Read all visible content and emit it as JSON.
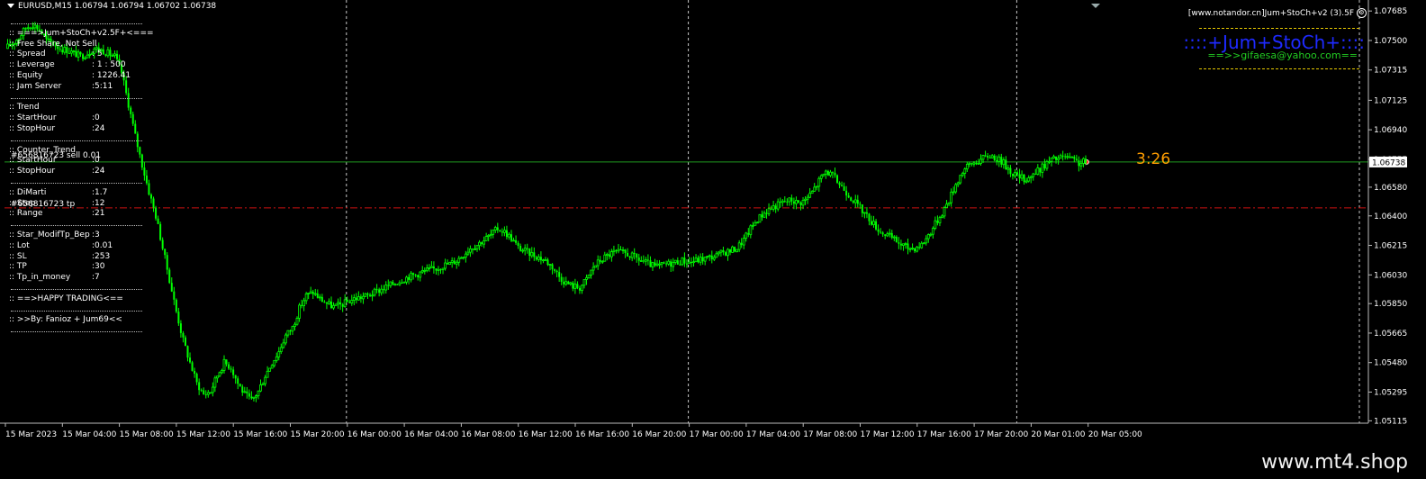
{
  "header": {
    "symbol_info": "EURUSD,M15  1.06794 1.06794 1.06702 1.06738"
  },
  "indicator": {
    "name": "[www.notandor.cn]Jum+StoCh+v2 (3).5F",
    "brand": "::::+Jum+StoCh+::::",
    "email": "==>>gifaesa@yahoo.com=="
  },
  "timer": "3:26",
  "orders": {
    "sell_label": "#656816723 sell 0.01",
    "tp_label": "#656816723 tp"
  },
  "panel": [
    {
      "type": "sep"
    },
    {
      "label": ":: ===>Jum+StoCh+v2.5F+<==="
    },
    {
      "label": ":: Free Share, Not Sell"
    },
    {
      "label": ":: Spread",
      "value": ": 5"
    },
    {
      "label": ":: Leverage",
      "value": ": 1 : 500"
    },
    {
      "label": ":: Equity",
      "value": ": 1226.41"
    },
    {
      "label": ":: Jam Server",
      "value": "  :5:11"
    },
    {
      "type": "sep"
    },
    {
      "label": ":: Trend"
    },
    {
      "label": ":: StartHour",
      "value": ":0"
    },
    {
      "label": ":: StopHour",
      "value": ":24"
    },
    {
      "type": "sep"
    },
    {
      "label": ":: Counter_Trend"
    },
    {
      "label": ":: StartHour",
      "value": ":0"
    },
    {
      "label": ":: StopHour",
      "value": ":24"
    },
    {
      "type": "sep"
    },
    {
      "label": ":: DiMarti",
      "value": ":1.7"
    },
    {
      "label": ":: Step",
      "value": ":12"
    },
    {
      "label": ":: Range",
      "value": ":21"
    },
    {
      "type": "sep"
    },
    {
      "label": ":: Star_ModifTp_Bep",
      "value": ":3"
    },
    {
      "label": ":: Lot",
      "value": ":0.01"
    },
    {
      "label": ":: SL",
      "value": ":253"
    },
    {
      "label": ":: TP",
      "value": ":30"
    },
    {
      "label": ":: Tp_in_money",
      "value": ":7"
    },
    {
      "type": "sep"
    },
    {
      "label": ":: ==>HAPPY TRADING<=="
    },
    {
      "type": "sep"
    },
    {
      "label": ":: >>By: Fanioz + Jum69<<"
    },
    {
      "type": "sep"
    }
  ],
  "footer": {
    "watermark": "www.mt4.shop"
  },
  "colors": {
    "background": "#000000",
    "candle": "#00ff00",
    "bid_line": "#1f9a1f",
    "tp_line": "#cc1111",
    "grid": "#c8c8c8",
    "timer": "#ff9d00",
    "brand": "#1e2aff",
    "email": "#22cc22",
    "price_tag_bg": "#ffffff"
  },
  "chart_data": {
    "type": "candlestick",
    "symbol": "EURUSD",
    "timeframe": "M15",
    "price_axis_ticks": [
      "1.07685",
      "1.07500",
      "1.07315",
      "1.07125",
      "1.06940",
      "1.06755",
      "1.06580",
      "1.06400",
      "1.06215",
      "1.06030",
      "1.05850",
      "1.05665",
      "1.05480",
      "1.05295",
      "1.05115"
    ],
    "ylim": [
      1.051,
      1.0772
    ],
    "current_price": "1.06738",
    "tp_level": 1.0645,
    "time_axis_labels": [
      "15 Mar 2023",
      "15 Mar 04:00",
      "15 Mar 08:00",
      "15 Mar 12:00",
      "15 Mar 16:00",
      "15 Mar 20:00",
      "16 Mar 00:00",
      "16 Mar 04:00",
      "16 Mar 08:00",
      "16 Mar 12:00",
      "16 Mar 16:00",
      "16 Mar 20:00",
      "17 Mar 00:00",
      "17 Mar 04:00",
      "17 Mar 08:00",
      "17 Mar 12:00",
      "17 Mar 16:00",
      "17 Mar 20:00",
      "20 Mar 01:00",
      "20 Mar 05:00"
    ],
    "day_separators": [
      "16 Mar 00:00",
      "17 Mar 00:00",
      "20 Mar 00:00"
    ],
    "price_path": [
      1.0745,
      1.0748,
      1.0752,
      1.0758,
      1.076,
      1.0757,
      1.075,
      1.0748,
      1.0745,
      1.0744,
      1.0742,
      1.074,
      1.0742,
      1.0745,
      1.0744,
      1.0742,
      1.074,
      1.073,
      1.071,
      1.069,
      1.0672,
      1.0655,
      1.064,
      1.062,
      1.06,
      1.058,
      1.0562,
      1.0548,
      1.0535,
      1.0528,
      1.053,
      1.054,
      1.0548,
      1.0545,
      1.0535,
      1.0528,
      1.0524,
      1.053,
      1.054,
      1.0548,
      1.0555,
      1.0565,
      1.057,
      1.0582,
      1.059,
      1.0592,
      1.0588,
      1.0585,
      1.0583,
      1.0584,
      1.0586,
      1.0588,
      1.0589,
      1.059,
      1.0592,
      1.0594,
      1.0596,
      1.0598,
      1.06,
      1.0602,
      1.0603,
      1.0605,
      1.0606,
      1.0607,
      1.0609,
      1.061,
      1.0612,
      1.0616,
      1.062,
      1.0622,
      1.0625,
      1.0628,
      1.0632,
      1.063,
      1.0626,
      1.062,
      1.0618,
      1.0616,
      1.0614,
      1.0612,
      1.0608,
      1.0602,
      1.0598,
      1.0596,
      1.0595,
      1.06,
      1.0608,
      1.0612,
      1.0615,
      1.0617,
      1.0617,
      1.0616,
      1.0614,
      1.0612,
      1.061,
      1.0608,
      1.0609,
      1.061,
      1.0611,
      1.0612,
      1.0611,
      1.0612,
      1.0613,
      1.0614,
      1.0615,
      1.0617,
      1.0618,
      1.062,
      1.0625,
      1.0632,
      1.0638,
      1.0642,
      1.0645,
      1.0647,
      1.0649,
      1.065,
      1.0648,
      1.065,
      1.0655,
      1.0662,
      1.0668,
      1.0665,
      1.066,
      1.0655,
      1.065,
      1.0645,
      1.064,
      1.0635,
      1.063,
      1.0628,
      1.0625,
      1.0622,
      1.062,
      1.062,
      1.0622,
      1.0628,
      1.0635,
      1.0642,
      1.065,
      1.066,
      1.0668,
      1.0672,
      1.0674,
      1.0676,
      1.0678,
      1.0676,
      1.0673,
      1.0668,
      1.0665,
      1.0663,
      1.0665,
      1.0668,
      1.0672,
      1.0675,
      1.0676,
      1.0677,
      1.0675,
      1.0673,
      1.0674
    ]
  }
}
